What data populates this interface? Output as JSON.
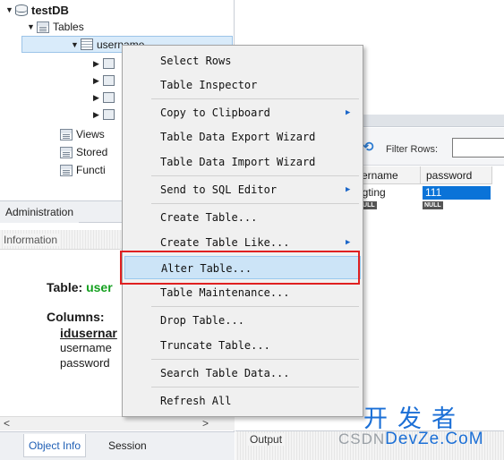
{
  "navigator": {
    "tree": {
      "db": "testDB",
      "tables_folder": "Tables",
      "table": "username",
      "views": "Views",
      "stored": "Stored",
      "functions": "Functi"
    },
    "admin_tab": "Administration",
    "info_header": "Information",
    "info": {
      "table_label": "Table:",
      "table_name": "user",
      "columns_label": "Columns:",
      "columns": [
        "idusernar",
        "username",
        "password"
      ]
    },
    "hscroll_left": "<",
    "hscroll_right": ">",
    "bottom_tabs": {
      "object_info": "Object Info",
      "session": "Session"
    }
  },
  "result": {
    "filter_label": "Filter Rows:",
    "filter_value": "",
    "columns": [
      "sername",
      "password"
    ],
    "row": [
      "ngting",
      "111"
    ],
    "null_badges": [
      "NULL",
      "NULL"
    ]
  },
  "output": {
    "label": "Output"
  },
  "context_menu": {
    "items": [
      {
        "label": "Select Rows"
      },
      {
        "label": "Table Inspector"
      },
      {
        "label": "Copy to Clipboard",
        "submenu": true
      },
      {
        "label": "Table Data Export Wizard"
      },
      {
        "label": "Table Data Import Wizard"
      },
      {
        "label": "Send to SQL Editor",
        "submenu": true
      },
      {
        "label": "Create Table..."
      },
      {
        "label": "Create Table Like...",
        "submenu": true
      },
      {
        "label": "Alter Table...",
        "highlighted": true
      },
      {
        "label": "Table Maintenance..."
      },
      {
        "label": "Drop Table..."
      },
      {
        "label": "Truncate Table..."
      },
      {
        "label": "Search Table Data..."
      },
      {
        "label": "Refresh All"
      }
    ],
    "submenu_glyph": "▶"
  },
  "watermark": {
    "cn": "开发者",
    "csdn": "CSDN",
    "en": "DevZe.CoM"
  },
  "colors": {
    "accent": "#0a73d8",
    "highlight_border": "#e02020",
    "green": "#14a01f",
    "watermark": "#1b6fd6"
  }
}
